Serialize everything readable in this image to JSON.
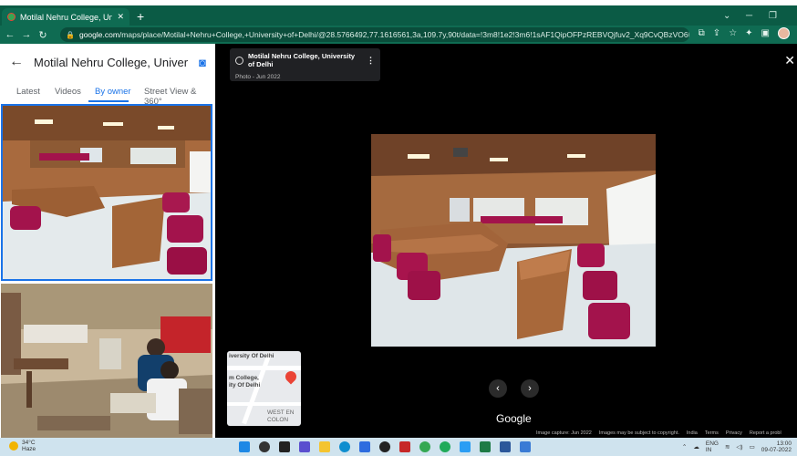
{
  "browser": {
    "tab_title": "Motilal Nehru College, Universit...",
    "new_tab": "+",
    "url_host": "google.com",
    "url_rest": "/maps/place/Motilal+Nehru+College,+University+of+Delhi/@28.5766492,77.1616561,3a,109.7y,90t/data=!3m8!1e2!3m6!1sAF1QipOFPzREBVQjfuv2_Xq9CvQBzVO6IHN1zPq..."
  },
  "panel": {
    "place_name": "Motilal Nehru College, University ...",
    "tabs": [
      "Latest",
      "Videos",
      "By owner",
      "Street View & 360°"
    ]
  },
  "viewer": {
    "title": "Motilal Nehru College, University of Delhi",
    "subtitle": "Photo - Jun 2022",
    "google": "Google",
    "map_labels": [
      "iversity Of Delhi",
      "m College,",
      "ity Of Delhi",
      "WEST EN",
      "COLON"
    ],
    "footer": [
      "Image capture: Jun 2022",
      "Images may be subject to copyright.",
      "India",
      "Terms",
      "Privacy",
      "Report a probl"
    ]
  },
  "taskbar": {
    "temp": "34°C",
    "cond": "Haze",
    "lang1": "ENG",
    "lang2": "IN",
    "time": "13:00",
    "date": "09-07-2022"
  },
  "colors": {
    "browser": "#0f6b52",
    "accent": "#1a73e8",
    "viewer_bg": "#000000"
  }
}
